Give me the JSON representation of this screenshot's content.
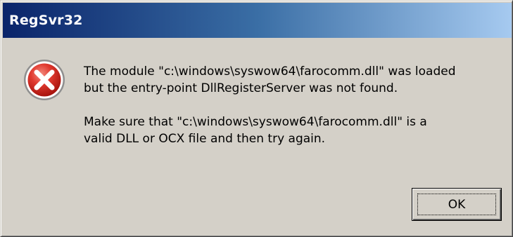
{
  "window": {
    "title": "RegSvr32"
  },
  "dialog": {
    "icon": "error-icon",
    "message_line1": "The module \"c:\\windows\\syswow64\\farocomm.dll\" was loaded",
    "message_line2": "but the entry-point DllRegisterServer was not found.",
    "message_line3": "Make sure that \"c:\\windows\\syswow64\\farocomm.dll\" is a",
    "message_line4": "valid DLL or OCX file and then try again.",
    "ok_label": "OK"
  },
  "colors": {
    "titlebar_start": "#0a246a",
    "titlebar_end": "#a6caf0",
    "dialog_background": "#d4d0c8",
    "error_red": "#d7261f"
  }
}
